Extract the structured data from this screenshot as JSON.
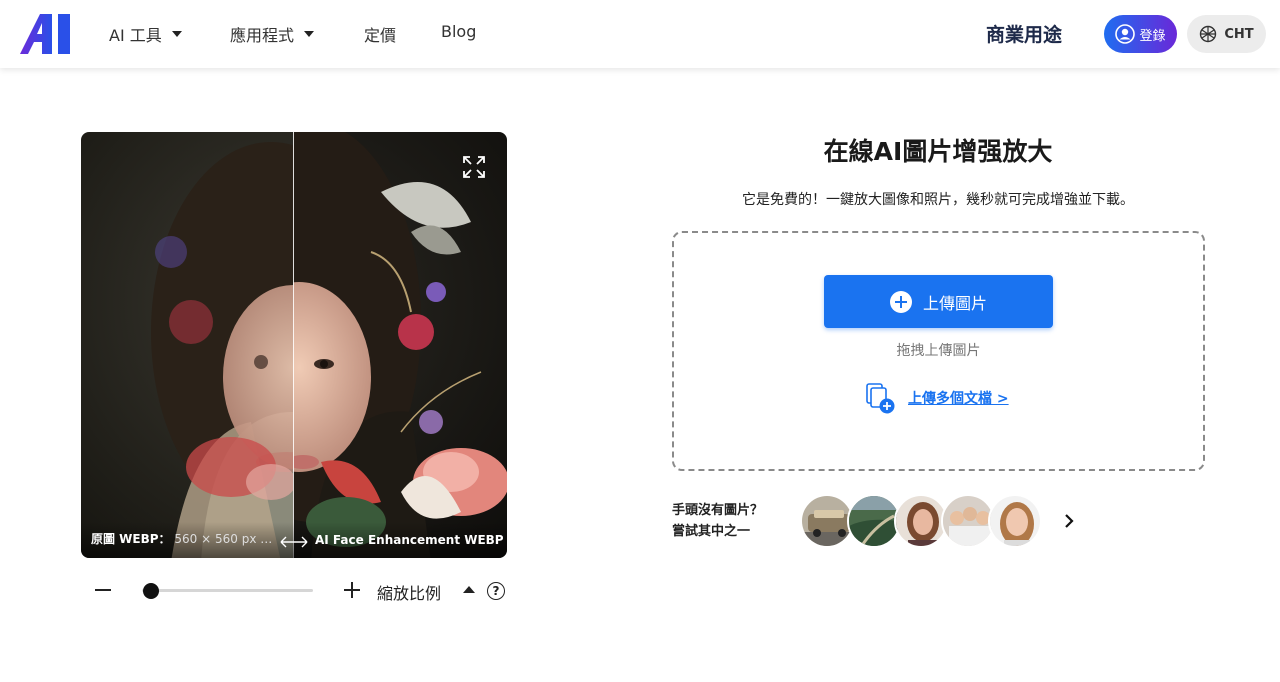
{
  "nav": {
    "items": [
      {
        "label": "AI 工具",
        "dropdown": true
      },
      {
        "label": "應用程式",
        "dropdown": true
      },
      {
        "label": "定價",
        "dropdown": false
      },
      {
        "label": "Blog",
        "dropdown": false
      }
    ],
    "business_label": "商業用途",
    "login_label": "登錄",
    "lang_label": "CHT"
  },
  "compare": {
    "left_label": "原圖 WEBP：",
    "left_size": "560 × 560 px …",
    "right_label": "AI Face Enhancement WEBP: …"
  },
  "zoom": {
    "label": "縮放比例",
    "help": "?",
    "level": 0.05
  },
  "main": {
    "title": "在線AI圖片增强放大",
    "subtitle": "它是免費的！一鍵放大圖像和照片，幾秒就可完成增強並下載。",
    "upload_label": "上傳圖片",
    "drag_hint": "拖拽上傳圖片",
    "multi_label": "上傳多個文檔 >",
    "try_line1": "手頭沒有圖片？",
    "try_line2": "嘗試其中之一"
  },
  "colors": {
    "accent": "#1a73f0",
    "login_gradient_start": "#1f6df0",
    "login_gradient_end": "#6a28d8",
    "business_text": "#1e2a4a"
  }
}
